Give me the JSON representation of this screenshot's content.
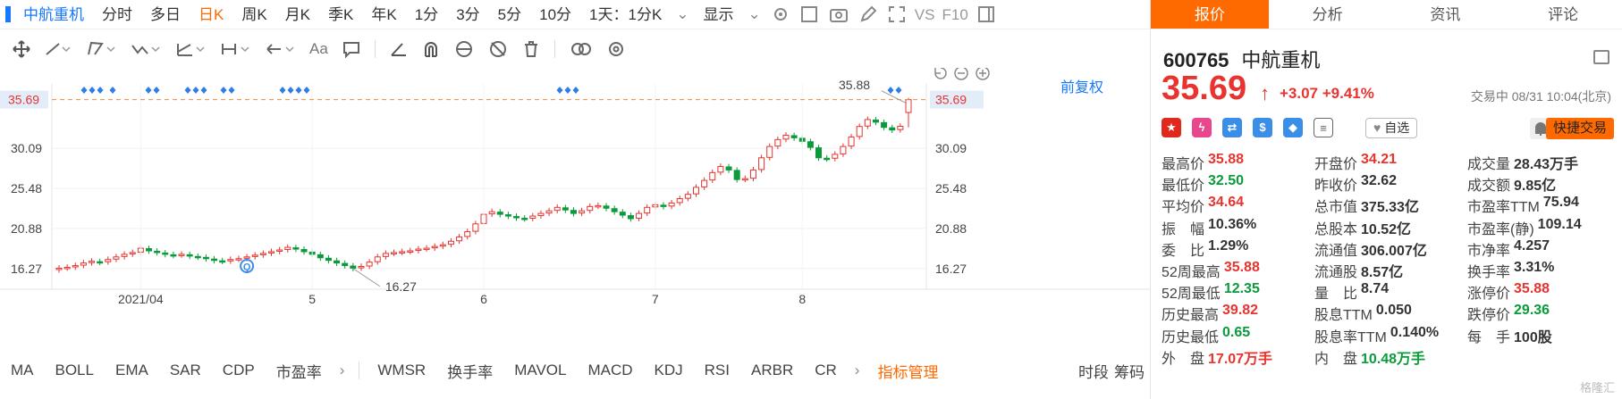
{
  "period_bar": {
    "stock_name": "中航重机",
    "tabs": [
      "分时",
      "多日",
      "日K",
      "周K",
      "月K",
      "季K",
      "年K",
      "1分",
      "3分",
      "5分",
      "10分",
      "1天：1分K"
    ],
    "active_tab": "日K",
    "display_label": "显示",
    "vs_label": "VS",
    "f10_label": "F10"
  },
  "draw_tools": {
    "text_tool_label": "Aa"
  },
  "chart": {
    "adjust_label": "前复权",
    "last_price_label": "35.69",
    "y_ticks": [
      "30.09",
      "25.48",
      "20.88",
      "16.27"
    ],
    "x_ticks": [
      "2021/04",
      "5",
      "6",
      "7",
      "8"
    ],
    "high_label": "35.88",
    "low_label": "16.27",
    "marker_letter": "Q"
  },
  "indicators": {
    "items": [
      "MA",
      "BOLL",
      "EMA",
      "SAR",
      "CDP",
      "市盈率"
    ],
    "items2": [
      "WMSR",
      "换手率",
      "MAVOL",
      "MACD",
      "KDJ",
      "RSI",
      "ARBR",
      "CR"
    ],
    "manage_label": "指标管理",
    "right_labels": [
      "时段",
      "筹码"
    ]
  },
  "right_tabs": [
    "报价",
    "分析",
    "资讯",
    "评论"
  ],
  "quote": {
    "code": "600765",
    "name": "中航重机",
    "price": "35.69",
    "change": "+3.07",
    "change_pct": "+9.41%",
    "status": "交易中 08/31 10:04(北京)",
    "watch_label": "自选",
    "trade_label": "快捷交易"
  },
  "stats": [
    [
      {
        "label": "最高价",
        "value": "35.88",
        "color": "red"
      },
      {
        "label": "开盘价",
        "value": "34.21",
        "color": "red"
      },
      {
        "label": "成交量",
        "value": "28.43万手",
        "color": "dark"
      }
    ],
    [
      {
        "label": "最低价",
        "value": "32.50",
        "color": "green"
      },
      {
        "label": "昨收价",
        "value": "32.62",
        "color": "dark"
      },
      {
        "label": "成交额",
        "value": "9.85亿",
        "color": "dark"
      }
    ],
    [
      {
        "label": "平均价",
        "value": "34.64",
        "color": "red"
      },
      {
        "label": "总市值",
        "value": "375.33亿",
        "color": "dark"
      },
      {
        "label": "市盈率TTM",
        "value": "75.94",
        "color": "dark"
      }
    ],
    [
      {
        "label": "振　幅",
        "value": "10.36%",
        "color": "dark"
      },
      {
        "label": "总股本",
        "value": "10.52亿",
        "color": "dark"
      },
      {
        "label": "市盈率(静)",
        "value": "109.14",
        "color": "dark"
      }
    ],
    [
      {
        "label": "委　比",
        "value": "1.29%",
        "color": "dark"
      },
      {
        "label": "流通值",
        "value": "306.007亿",
        "color": "dark"
      },
      {
        "label": "市净率",
        "value": "4.257",
        "color": "dark"
      }
    ],
    [
      {
        "label": "52周最高",
        "value": "35.88",
        "color": "red"
      },
      {
        "label": "流通股",
        "value": "8.57亿",
        "color": "dark"
      },
      {
        "label": "换手率",
        "value": "3.31%",
        "color": "dark"
      }
    ],
    [
      {
        "label": "52周最低",
        "value": "12.35",
        "color": "green"
      },
      {
        "label": "量　比",
        "value": "8.74",
        "color": "dark"
      },
      {
        "label": "涨停价",
        "value": "35.88",
        "color": "red"
      }
    ],
    [
      {
        "label": "历史最高",
        "value": "39.82",
        "color": "red"
      },
      {
        "label": "股息TTM",
        "value": "0.050",
        "color": "dark"
      },
      {
        "label": "跌停价",
        "value": "29.36",
        "color": "green"
      }
    ],
    [
      {
        "label": "历史最低",
        "value": "0.65",
        "color": "green"
      },
      {
        "label": "股息率TTM",
        "value": "0.140%",
        "color": "dark"
      },
      {
        "label": "每　手",
        "value": "100股",
        "color": "dark"
      }
    ],
    [
      {
        "label": "外　盘",
        "value": "17.07万手",
        "color": "red"
      },
      {
        "label": "内　盘",
        "value": "10.48万手",
        "color": "green"
      },
      {
        "label": "",
        "value": "",
        "color": "dark"
      }
    ]
  ],
  "watermark": "格隆汇",
  "colors": {
    "up": "#e8332f",
    "down": "#0a9b3b",
    "accent": "#ff6a00",
    "link": "#1677ff"
  },
  "chart_data": {
    "type": "candlestick",
    "y_ticks": [
      30.09,
      25.48,
      20.88,
      16.27
    ],
    "ylim": [
      14.5,
      37.5
    ],
    "x_ticks": [
      "2021/04",
      "5",
      "6",
      "7",
      "8"
    ],
    "last_price": 35.69,
    "high": 35.88,
    "low": 16.27,
    "closes": [
      16.3,
      16.4,
      16.6,
      16.9,
      17.1,
      17.0,
      17.3,
      17.6,
      17.9,
      18.1,
      18.6,
      18.3,
      18.1,
      17.9,
      17.8,
      17.9,
      17.7,
      17.6,
      17.4,
      17.2,
      17.1,
      17.3,
      17.4,
      17.6,
      17.8,
      18.0,
      18.2,
      18.4,
      18.7,
      18.5,
      18.2,
      17.9,
      17.5,
      17.2,
      16.9,
      16.6,
      16.3,
      16.5,
      17.0,
      17.6,
      18.0,
      18.1,
      18.2,
      18.3,
      18.5,
      18.6,
      18.8,
      19.0,
      19.4,
      19.9,
      20.5,
      21.4,
      22.5,
      22.8,
      22.5,
      22.3,
      22.1,
      22.0,
      22.3,
      22.6,
      22.9,
      23.3,
      23.0,
      22.6,
      22.9,
      23.4,
      23.5,
      23.2,
      22.8,
      22.4,
      22.0,
      22.6,
      23.3,
      23.6,
      23.4,
      23.8,
      24.3,
      24.8,
      25.6,
      26.4,
      27.3,
      28.0,
      27.6,
      26.5,
      26.6,
      27.6,
      29.0,
      30.3,
      31.1,
      31.6,
      31.3,
      30.9,
      30.2,
      29.0,
      28.9,
      29.4,
      30.3,
      31.4,
      32.6,
      33.4,
      33.1,
      32.5,
      32.2,
      32.62,
      35.69
    ],
    "signal_groups": [
      3,
      1,
      2,
      3,
      2,
      4,
      3,
      2
    ]
  }
}
